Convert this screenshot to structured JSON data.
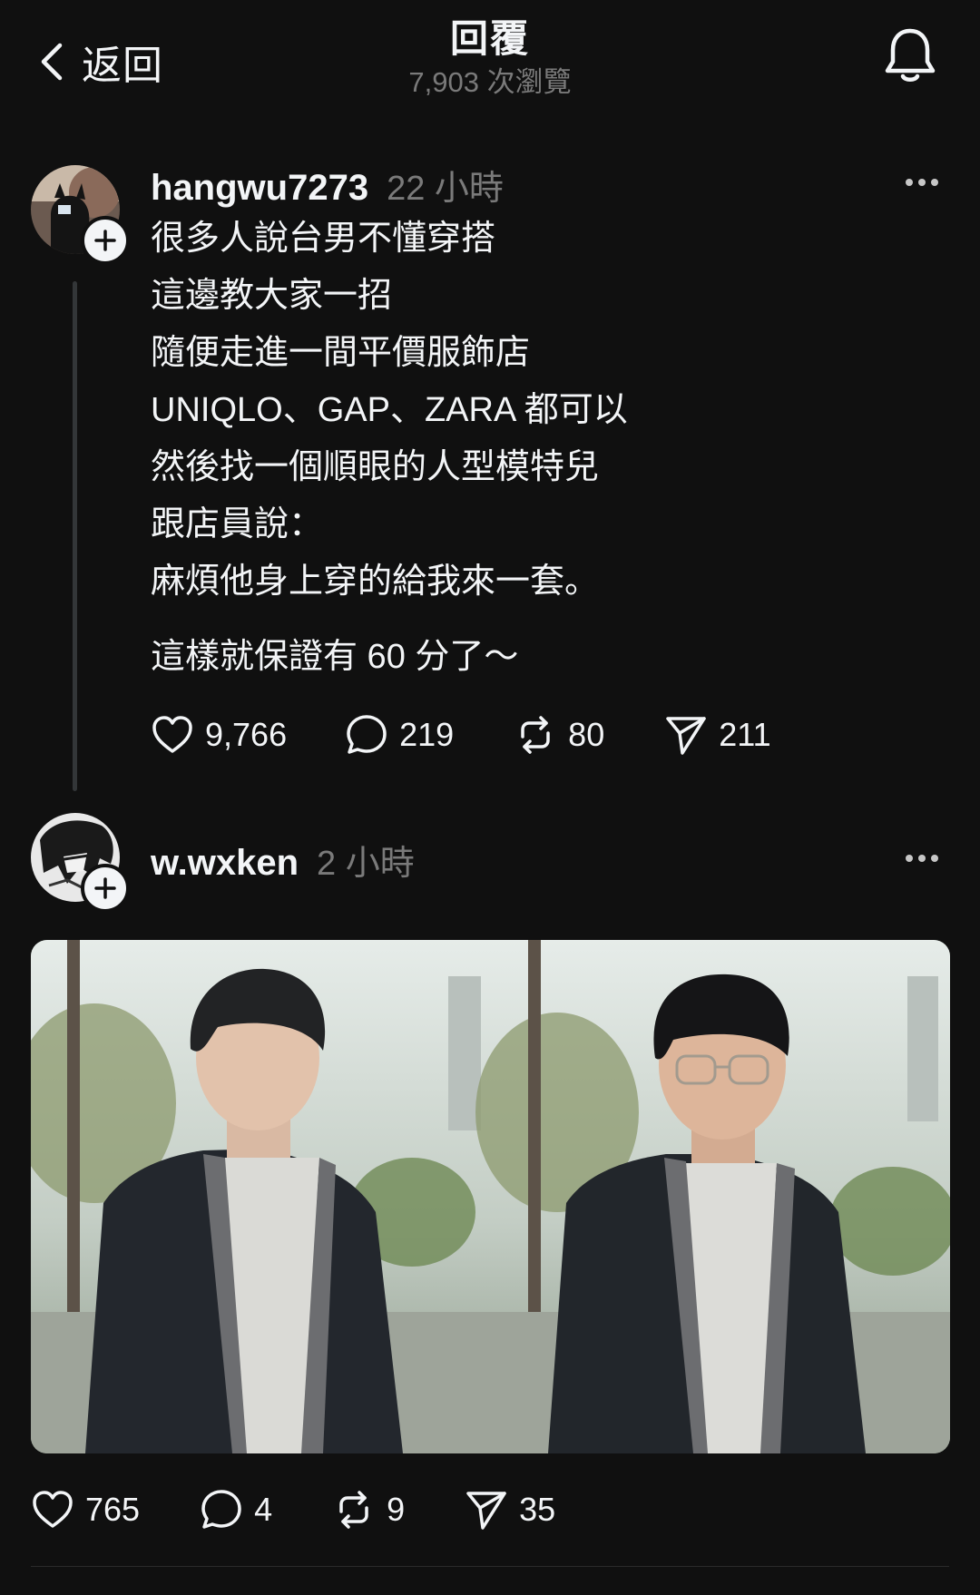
{
  "header": {
    "back_label": "返回",
    "title": "回覆",
    "views": "7,903 次瀏覽",
    "back_icon": "chevron-left-icon",
    "bell_icon": "bell-icon"
  },
  "posts": [
    {
      "username": "hangwu7273",
      "time": "22 小時",
      "lines": [
        "很多人說台男不懂穿搭",
        "這邊教大家一招",
        "隨便走進一間平價服飾店",
        "UNIQLO、GAP、ZARA 都可以",
        "然後找一個順眼的人型模特兒",
        "跟店員說：",
        "麻煩他身上穿的給我來一套。",
        "這樣就保證有 60 分了～"
      ],
      "likes": "9,766",
      "comments": "219",
      "reposts": "80",
      "shares": "211"
    },
    {
      "username": "w.wxken",
      "time": "2 小時",
      "likes": "765",
      "comments": "4",
      "reposts": "9",
      "shares": "35"
    }
  ],
  "icons": {
    "like": "heart-icon",
    "comment": "comment-bubble-icon",
    "repost": "repost-icon",
    "share": "send-icon",
    "more": "more-dots-icon",
    "follow": "plus-icon"
  },
  "colors": {
    "background": "#101010",
    "text": "#f3f5f7",
    "muted": "#7a7a7a",
    "thread_line": "#333638"
  }
}
